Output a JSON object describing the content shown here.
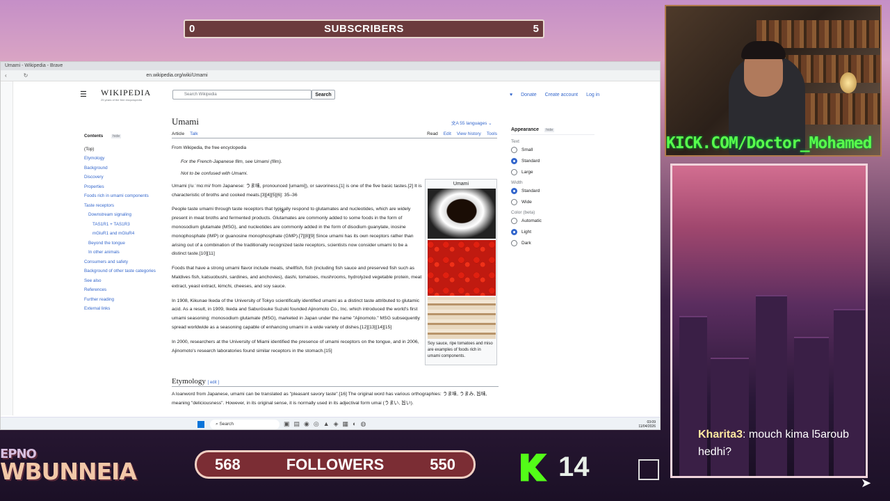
{
  "stream": {
    "subscribers": {
      "left": "0",
      "label": "SUBSCRIBERS",
      "right": "5"
    },
    "followers": {
      "left": "568",
      "label": "FOLLOWERS",
      "right": "550"
    },
    "kick_url": "KICK.COM/Doctor_Mohamed",
    "kick_count": "14",
    "chat": {
      "user": "Kharita3",
      "message": ": mouch kima l5aroub hedhi?"
    },
    "logo_text": "WBUNNEIA",
    "logo_small": "EPNO"
  },
  "browser": {
    "tab_title": "Umami - Wikipedia - Brave",
    "url": "en.wikipedia.org/wiki/Umami"
  },
  "wiki": {
    "logo_title": "WIKIPEDIA",
    "logo_sub": "25 years of the free encyclopedia",
    "search_placeholder": "Search Wikipedia",
    "search_button": "Search",
    "header_links": [
      "Donate",
      "Create account",
      "Log in"
    ],
    "title": "Umami",
    "languages": "55 languages",
    "tabs_left": [
      "Article",
      "Talk"
    ],
    "tabs_right": [
      "Read",
      "Edit",
      "View history",
      "Tools"
    ],
    "from": "From Wikipedia, the free encyclopedia",
    "note1": "For the French-Japanese film, see Umami (film).",
    "note2": "Not to be confused with Umami.",
    "para1": "Umami (/uːˈmɑːmi/ from Japanese: うま味, pronounced [umami]), or savoriness,[1] is one of the five basic tastes.[2] It is characteristic of broths and cooked meats.[3][4][5][6]: 35–36",
    "para2": "People taste umami through taste receptors that typically respond to glutamates and nucleotides, which are widely present in meat broths and fermented products. Glutamates are commonly added to some foods in the form of monosodium glutamate (MSG), and nucleotides are commonly added in the form of disodium guanylate, inosine monophosphate (IMP) or guanosine monophosphate (GMP).[7][8][9] Since umami has its own receptors rather than arising out of a combination of the traditionally recognized taste receptors, scientists now consider umami to be a distinct taste.[10][11]",
    "para3": "Foods that have a strong umami flavor include meats, shellfish, fish (including fish sauce and preserved fish such as Maldives fish, katsuobushi, sardines, and anchovies), dashi, tomatoes, mushrooms, hydrolyzed vegetable protein, meat extract, yeast extract, kimchi, cheeses, and soy sauce.",
    "para4": "In 1908, Kikunae Ikeda of the University of Tokyo scientifically identified umami as a distinct taste attributed to glutamic acid. As a result, in 1909, Ikeda and Saburōsuke Suzuki founded Ajinomoto Co., Inc. which introduced the world's first umami seasoning: monosodium glutamate (MSG), marketed in Japan under the name \"Ajinomoto.\" MSG subsequently spread worldwide as a seasoning capable of enhancing umami in a wide variety of dishes.[12][13][14][15]",
    "para5": "In 2000, researchers at the University of Miami identified the presence of umami receptors on the tongue, and in 2006, Ajinomoto's research laboratories found similar receptors in the stomach.[15]",
    "infobox_title": "Umami",
    "infobox_caption": "Soy sauce, ripe tomatoes and miso are examples of foods rich in umami components.",
    "section_title": "Etymology",
    "section_edit": "[ edit ]",
    "etym_text": "A loanword from Japanese, umami can be translated as \"pleasant savory taste\".[16] The original word has various orthographies: うま味, うまみ, 旨味, meaning \"deliciousness\". However, in its original sense, it is normally used in its adjectival form umai (うまい, 旨い).",
    "toc": {
      "heading": "Contents",
      "hide": "hide",
      "items": [
        {
          "label": "(Top)",
          "level": 0
        },
        {
          "label": "Etymology",
          "level": 0
        },
        {
          "label": "Background",
          "level": 0
        },
        {
          "label": "Discovery",
          "level": 0
        },
        {
          "label": "Properties",
          "level": 0
        },
        {
          "label": "Foods rich in umami components",
          "level": 0
        },
        {
          "label": "Taste receptors",
          "level": 0
        },
        {
          "label": "Downstream signaling",
          "level": 1
        },
        {
          "label": "TAS1R1 + TAS1R3",
          "level": 2
        },
        {
          "label": "mGluR1 and mGluR4",
          "level": 2
        },
        {
          "label": "Beyond the tongue",
          "level": 1
        },
        {
          "label": "In other animals",
          "level": 1
        },
        {
          "label": "Consumers and safety",
          "level": 0
        },
        {
          "label": "Background of other taste categories",
          "level": 0
        },
        {
          "label": "See also",
          "level": 0
        },
        {
          "label": "References",
          "level": 0
        },
        {
          "label": "Further reading",
          "level": 0
        },
        {
          "label": "External links",
          "level": 0
        }
      ]
    },
    "appearance": {
      "heading": "Appearance",
      "hide": "hide",
      "text_label": "Text",
      "text_options": [
        {
          "label": "Small",
          "on": false
        },
        {
          "label": "Standard",
          "on": true
        },
        {
          "label": "Large",
          "on": false
        }
      ],
      "width_label": "Width",
      "width_options": [
        {
          "label": "Standard",
          "on": true
        },
        {
          "label": "Wide",
          "on": false
        }
      ],
      "color_label": "Color (beta)",
      "color_options": [
        {
          "label": "Automatic",
          "on": false
        },
        {
          "label": "Light",
          "on": true
        },
        {
          "label": "Dark",
          "on": false
        }
      ]
    }
  },
  "taskbar": {
    "search": "Search",
    "time": "03:09",
    "date": "11/04/2026"
  }
}
